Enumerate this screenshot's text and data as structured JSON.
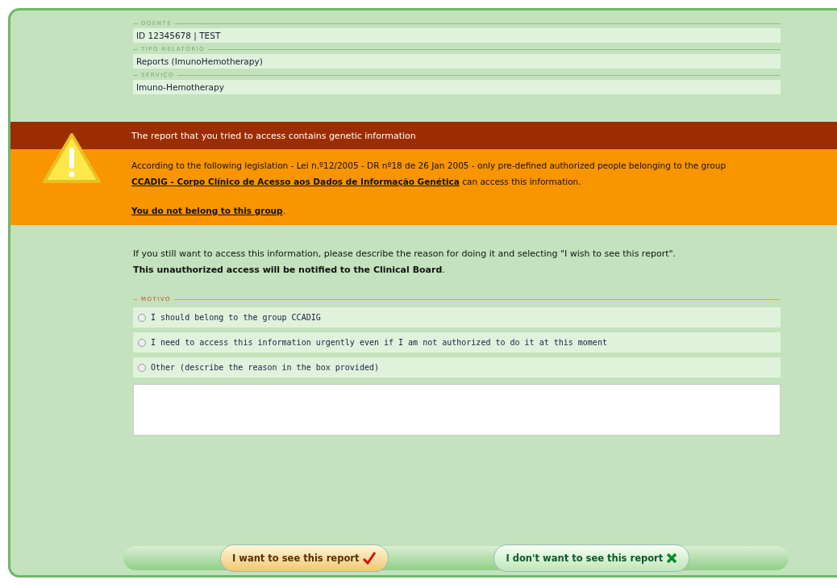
{
  "fields": [
    {
      "legend": "DOENTE",
      "value": "ID 12345678 | TEST"
    },
    {
      "legend": "TIPO RELATÓRIO",
      "value": "Reports (ImunoHemotherapy)"
    },
    {
      "legend": "SERVIÇO",
      "value": "Imuno-Hemotherapy"
    }
  ],
  "warning": {
    "title": "The report that you tried to access contains genetic information",
    "text_before": "According to the following legislation - Lei n.º12/2005 - DR nº18 de 26 Jan 2005 - only pre-defined authorized people belonging to the group",
    "group_link": "CCADIG - Corpo Clínico de Acesso aos Dados de Informação Genética",
    "text_after": "can access this information.",
    "not_member_link": "You do not belong to this group",
    "not_member_end": "."
  },
  "instructions": "If you still want to access this information, please describe the reason for doing it and selecting \"I wish to see this report\".",
  "notice": "**This unauthorized access will be notified to the Clinical Board**.",
  "reason_legend": "MOTIVO",
  "reasons": [
    {
      "label": "I should belong to the group CCADIG",
      "selected": false
    },
    {
      "label": "I need to access this information urgently even if I am not authorized to do it at this moment",
      "selected": false
    },
    {
      "label": "Other (describe the reason in the box provided)",
      "selected": false
    }
  ],
  "buttons": [
    {
      "label": "I want to see this report",
      "kind": "accept"
    },
    {
      "label": "I don't want to see this report",
      "kind": "decline"
    }
  ]
}
